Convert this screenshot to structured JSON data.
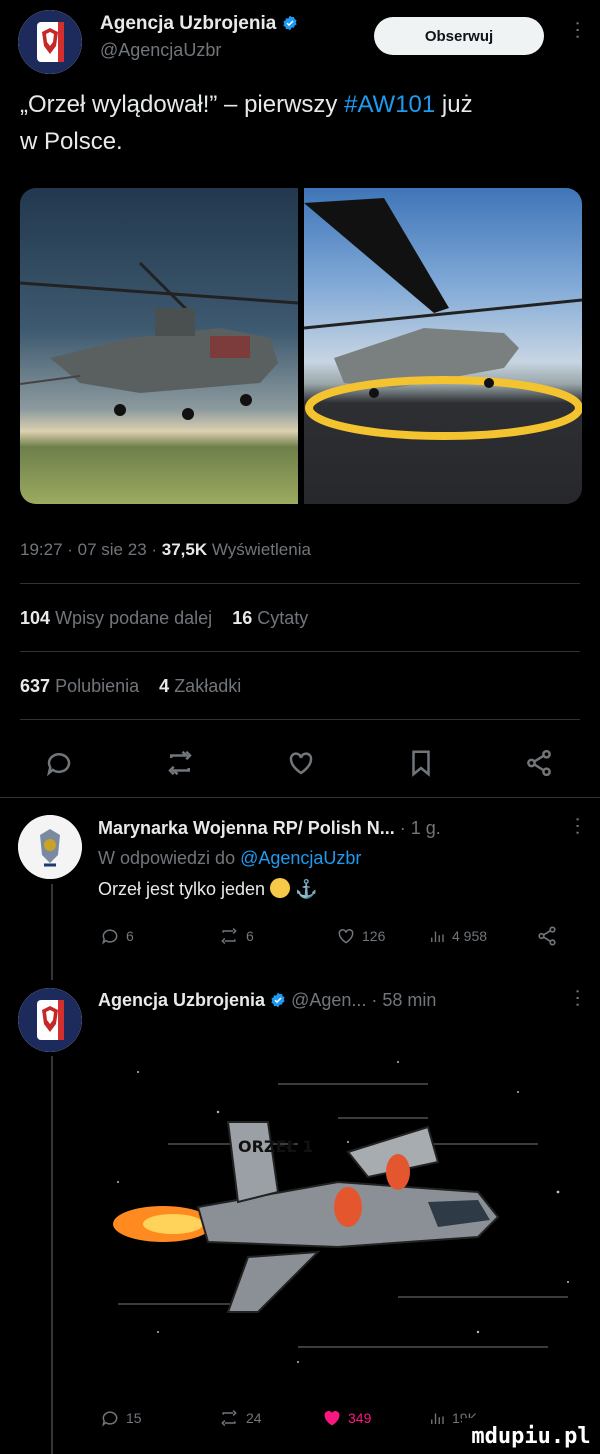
{
  "post": {
    "author_name": "Agencja Uzbrojenia",
    "author_handle": "@AgencjaUzbr",
    "follow_label": "Obserwuj",
    "text_main": "„Orzeł wylądował!” – pierwszy ",
    "hashtag": "#AW101",
    "text_tail": " już",
    "text_line2": "w Polsce.",
    "timestamp": "19:27 · 07 sie 23 · ",
    "views_count": "37,5K",
    "views_label": "Wyświetlenia",
    "reposts_count": "104",
    "reposts_label": "Wpisy podane dalej",
    "quotes_count": "16",
    "quotes_label": "Cytaty",
    "likes_count": "637",
    "likes_label": "Polubienia",
    "bookmarks_count": "4",
    "bookmarks_label": "Zakładki"
  },
  "reply1": {
    "author_name": "Marynarka Wojenna RP/ Polish N...",
    "time": " · 1 g.",
    "reply_to_prefix": "W odpowiedzi do ",
    "reply_to_handle": "@AgencjaUzbr",
    "text": "Orzeł jest tylko jeden ",
    "replies": "6",
    "reposts": "6",
    "likes": "126",
    "views": "4 958"
  },
  "reply2": {
    "author_name": "Agencja Uzbrojenia",
    "handle_time": "@Agen... · 58 min",
    "image_text": "ORZEŁ 1",
    "replies": "15",
    "reposts": "24",
    "likes": "349",
    "views": "19K"
  },
  "watermark": "mdupiu.pl",
  "colors": {
    "accent": "#1d9bf0",
    "like": "#f91880",
    "muted": "#71767b"
  }
}
